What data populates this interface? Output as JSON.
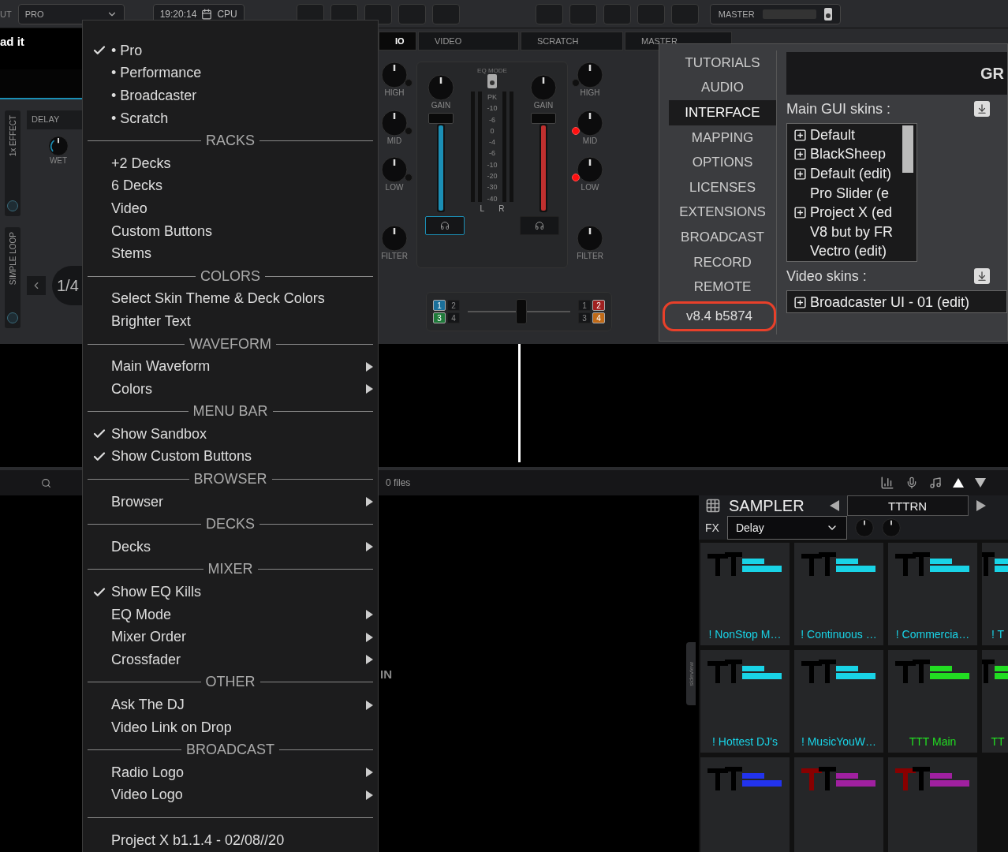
{
  "top_bar": {
    "layout_label": "UT",
    "layout_value": "PRO",
    "clock": "19:20:14",
    "cpu_label": "CPU",
    "master_label": "MASTER"
  },
  "deck": {
    "title": "ad it",
    "effect_label": "1x EFFECT",
    "effect_name": "DELAY",
    "knob_label": "WET",
    "loop_label": "SIMPLE LOOP",
    "loop_size": "1/4"
  },
  "tabs": [
    {
      "label": "IO",
      "selected": true
    },
    {
      "label": "VIDEO",
      "selected": false
    },
    {
      "label": "SCRATCH",
      "selected": false
    },
    {
      "label": "MASTER",
      "selected": false
    }
  ],
  "mixer": {
    "eq_mode_label": "EQ MODE",
    "left_eq": [
      {
        "label": "HIGH",
        "kill": false
      },
      {
        "label": "MID",
        "kill": false
      },
      {
        "label": "LOW",
        "kill": false
      },
      {
        "label": "FILTER"
      }
    ],
    "right_eq": [
      {
        "label": "HIGH",
        "kill": false
      },
      {
        "label": "MID",
        "kill": true
      },
      {
        "label": "LOW",
        "kill": true
      },
      {
        "label": "FILTER"
      }
    ],
    "channels": [
      {
        "gain_label": "GAIN",
        "color": "#1b8fb5",
        "level": 1,
        "headphone_on": true
      },
      {
        "gain_label": "GAIN",
        "color": "#c0302f",
        "level": 1,
        "headphone_on": false
      }
    ],
    "meter_scale": [
      "PK",
      "-10",
      "-6",
      "0",
      "-4",
      "-6",
      "-10",
      "-20",
      "-30",
      "-40"
    ],
    "meter_channels": [
      "L",
      "R"
    ],
    "crossfader": {
      "level": 0.5,
      "left_assign": [
        {
          "label": "1",
          "selected": true,
          "color": "#1a6f9a"
        },
        {
          "label": "2",
          "selected": false
        },
        {
          "label": "3",
          "selected": true,
          "color": "#1f7a3a"
        },
        {
          "label": "4",
          "selected": false
        }
      ],
      "right_assign": [
        {
          "label": "1",
          "selected": false
        },
        {
          "label": "2",
          "selected": true,
          "color": "#a02020"
        },
        {
          "label": "3",
          "selected": false
        },
        {
          "label": "4",
          "selected": true,
          "color": "#c06a18"
        }
      ]
    }
  },
  "browser": {
    "file_count": "0 files",
    "side_text": "IN",
    "sideview_label": "sideview"
  },
  "sampler": {
    "title": "SAMPLER",
    "bank": "TTTRN",
    "fx_label": "FX",
    "fx_value": "Delay",
    "pads": [
      {
        "label": "! NonStop M…",
        "color": "#19d3e6"
      },
      {
        "label": "! Continuous …",
        "color": "#19d3e6"
      },
      {
        "label": "! Commercia…",
        "color": "#19d3e6"
      },
      {
        "label": "! T",
        "color": "#19d3e6"
      },
      {
        "label": "! Hottest DJ's",
        "color": "#19d3e6"
      },
      {
        "label": "! MusicYouW…",
        "color": "#19d3e6"
      },
      {
        "label": "TTT Main",
        "color": "#22dd22"
      },
      {
        "label": "TT",
        "color": "#22dd22"
      },
      {
        "color": "#2233ee"
      },
      {
        "color": "#a020a0"
      },
      {
        "color": "#a020a0"
      }
    ]
  },
  "menu": {
    "items": [
      {
        "kind": "item",
        "label": "• Pro",
        "checked": true,
        "submenu": false
      },
      {
        "kind": "item",
        "label": "• Performance",
        "checked": false,
        "submenu": false
      },
      {
        "kind": "item",
        "label": "• Broadcaster",
        "checked": false,
        "submenu": false
      },
      {
        "kind": "item",
        "label": "• Scratch",
        "checked": false,
        "submenu": false
      },
      {
        "kind": "header",
        "label": "RACKS"
      },
      {
        "kind": "item",
        "label": "+2 Decks",
        "checked": false,
        "submenu": false
      },
      {
        "kind": "item",
        "label": "6 Decks",
        "checked": false,
        "submenu": false
      },
      {
        "kind": "item",
        "label": "Video",
        "checked": false,
        "submenu": false
      },
      {
        "kind": "item",
        "label": "Custom Buttons",
        "checked": false,
        "submenu": false
      },
      {
        "kind": "item",
        "label": "Stems",
        "checked": false,
        "submenu": false
      },
      {
        "kind": "header",
        "label": "COLORS"
      },
      {
        "kind": "item",
        "label": "Select Skin Theme & Deck Colors",
        "checked": false,
        "submenu": false
      },
      {
        "kind": "item",
        "label": "Brighter Text",
        "checked": false,
        "submenu": false
      },
      {
        "kind": "header",
        "label": "WAVEFORM"
      },
      {
        "kind": "item",
        "label": "Main Waveform",
        "checked": false,
        "submenu": true
      },
      {
        "kind": "item",
        "label": "Colors",
        "checked": false,
        "submenu": true
      },
      {
        "kind": "header",
        "label": "MENU BAR"
      },
      {
        "kind": "item",
        "label": "Show Sandbox",
        "checked": true,
        "submenu": false
      },
      {
        "kind": "item",
        "label": "Show Custom Buttons",
        "checked": true,
        "submenu": false
      },
      {
        "kind": "header",
        "label": "BROWSER"
      },
      {
        "kind": "item",
        "label": "Browser",
        "checked": false,
        "submenu": true
      },
      {
        "kind": "header",
        "label": "DECKS"
      },
      {
        "kind": "item",
        "label": "Decks",
        "checked": false,
        "submenu": true
      },
      {
        "kind": "header",
        "label": "MIXER"
      },
      {
        "kind": "item",
        "label": "Show EQ Kills",
        "checked": true,
        "submenu": false
      },
      {
        "kind": "item",
        "label": "EQ Mode",
        "checked": false,
        "submenu": true
      },
      {
        "kind": "item",
        "label": "Mixer Order",
        "checked": false,
        "submenu": true
      },
      {
        "kind": "item",
        "label": "Crossfader",
        "checked": false,
        "submenu": true
      },
      {
        "kind": "header",
        "label": "OTHER"
      },
      {
        "kind": "item",
        "label": "Ask The DJ",
        "checked": false,
        "submenu": true
      },
      {
        "kind": "item",
        "label": "Video Link on Drop",
        "checked": false,
        "submenu": false
      },
      {
        "kind": "header",
        "label": "BROADCAST"
      },
      {
        "kind": "item",
        "label": "Radio Logo",
        "checked": false,
        "submenu": true
      },
      {
        "kind": "item",
        "label": "Video Logo",
        "checked": false,
        "submenu": true
      },
      {
        "kind": "divider"
      },
      {
        "kind": "item",
        "label": "Project X b1.1.4 - 02/08//20",
        "checked": false,
        "submenu": false
      }
    ]
  },
  "settings": {
    "nav": [
      {
        "label": "TUTORIALS",
        "selected": false
      },
      {
        "label": "AUDIO",
        "selected": false
      },
      {
        "label": "INTERFACE",
        "selected": true
      },
      {
        "label": "MAPPING",
        "selected": false
      },
      {
        "label": "OPTIONS",
        "selected": false
      },
      {
        "label": "LICENSES",
        "selected": false
      },
      {
        "label": "EXTENSIONS",
        "selected": false
      },
      {
        "label": "BROADCAST",
        "selected": false
      },
      {
        "label": "RECORD",
        "selected": false
      },
      {
        "label": "REMOTE",
        "selected": false
      }
    ],
    "version": "v8.4 b5874",
    "header_title": "GR",
    "sections": [
      {
        "title": "Main GUI skins :",
        "items": [
          {
            "label": "Default",
            "expandable": true
          },
          {
            "label": "BlackSheep",
            "expandable": true
          },
          {
            "label": "Default (edit)",
            "expandable": true
          },
          {
            "label": "Pro Slider (e",
            "expandable": false
          },
          {
            "label": "Project X (ed",
            "expandable": true
          },
          {
            "label": "V8 but by FR",
            "expandable": false
          },
          {
            "label": "Vectro (edit)",
            "expandable": false
          }
        ]
      },
      {
        "title": "Video skins :",
        "items": [
          {
            "label": "Broadcaster UI - 01 (edit)",
            "expandable": true
          }
        ]
      }
    ]
  }
}
